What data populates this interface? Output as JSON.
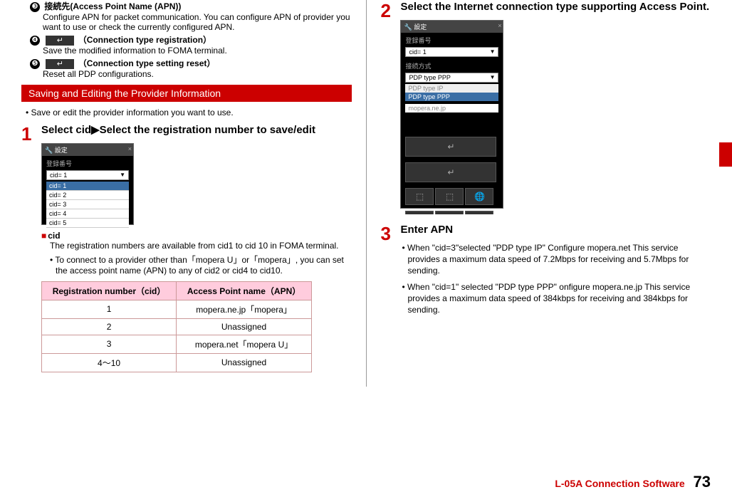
{
  "leftTop": {
    "item3": {
      "marker": "❸",
      "title": "接続先(Access Point Name (APN))",
      "desc": "Configure APN for packet communication. You can configure APN of provider you want to use or check the currently configured APN."
    },
    "item4": {
      "marker": "❹",
      "btn": "↵",
      "title": "（Connection type registration）",
      "desc": "Save the modified information to FOMA terminal."
    },
    "item5": {
      "marker": "❺",
      "btn": "↵",
      "title": "（Connection type setting reset）",
      "desc": "Reset all PDP configurations."
    }
  },
  "redHeader": "Saving and Editing the Provider Information",
  "saveEditBullet": "• Save or edit the provider information you want to use.",
  "step1": {
    "num": "1",
    "title": "Select cid▶Select the registration number to save/edit",
    "shot": {
      "title": "🔧 設定",
      "label": "登録番号",
      "selected": "cid= 1",
      "options": [
        "cid= 1",
        "cid= 2",
        "cid= 3",
        "cid= 4",
        "cid= 5"
      ]
    },
    "cidLabel": "cid",
    "cidDesc": "The registration numbers are available from cid1 to cid 10 in FOMA terminal.",
    "cidBullet": "• To connect to a provider other than「mopera U」or「mopera」, you can set the access point name (APN) to any of cid2 or cid4 to cid10."
  },
  "table": {
    "h1": "Registration number（cid）",
    "h2": "Access Point name（APN）",
    "rows": [
      {
        "c1": "1",
        "c2": "mopera.ne.jp「mopera」"
      },
      {
        "c1": "2",
        "c2": "Unassigned"
      },
      {
        "c1": "3",
        "c2": "mopera.net「mopera U」"
      },
      {
        "c1": "4～10",
        "c2": "Unassigned"
      }
    ]
  },
  "step2": {
    "num": "2",
    "title": "Select the Internet connection type supporting Access Point.",
    "shot": {
      "title": "🔧 設定",
      "label1": "登録番号",
      "cid": "cid= 1",
      "label2": "接続方式",
      "opts": [
        "PDP type PPP",
        "PDP type IP",
        "PDP type PPP"
      ],
      "apn": "mopera.ne.jp"
    }
  },
  "step3": {
    "num": "3",
    "title": "Enter APN",
    "b1": "• When \"cid=3\"selected \"PDP type IP\" Configure mopera.net This service provides a maximum data speed of 7.2Mbps for receiving and 5.7Mbps for sending.",
    "b2": "• When \"cid=1\" selected \"PDP type PPP\" onfigure mopera.ne.jp This service provides a maximum data speed of 384kbps for receiving and 384kbps for sending."
  },
  "footer": {
    "text": "L-05A Connection Software",
    "num": "73"
  }
}
